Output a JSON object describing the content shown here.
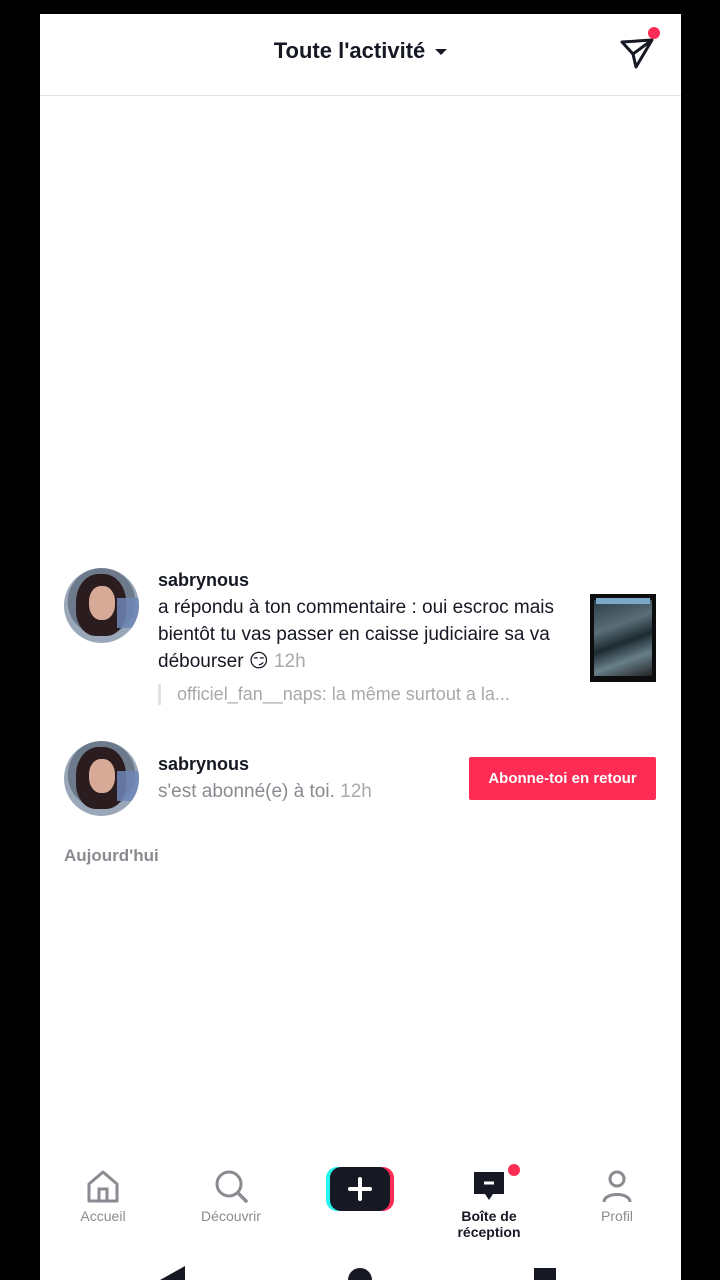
{
  "header": {
    "title": "Toute l'activité",
    "send_icon": "send-icon"
  },
  "notifications": [
    {
      "username": "sabrynous",
      "message": "a répondu à ton commentaire : oui escroc mais bientôt tu vas passer en caisse judiciaire sa va débourser 😏",
      "time": "12h",
      "quote": "officiel_fan__naps: la même surtout a la..."
    },
    {
      "username": "sabrynous",
      "message": "s'est abonné(e) à toi.",
      "time": "12h",
      "button_label": "Abonne-toi en retour"
    }
  ],
  "section_label": "Aujourd'hui",
  "bottom_nav": {
    "items": [
      {
        "label": "Accueil",
        "icon": "home-icon"
      },
      {
        "label": "Découvrir",
        "icon": "search-icon"
      },
      {
        "label": "",
        "icon": "plus-icon"
      },
      {
        "label": "Boîte de réception",
        "icon": "inbox-icon",
        "active": true
      },
      {
        "label": "Profil",
        "icon": "profile-icon"
      }
    ]
  },
  "colors": {
    "accent": "#fe2c55",
    "text": "#161823",
    "muted": "#a8a8ad"
  }
}
